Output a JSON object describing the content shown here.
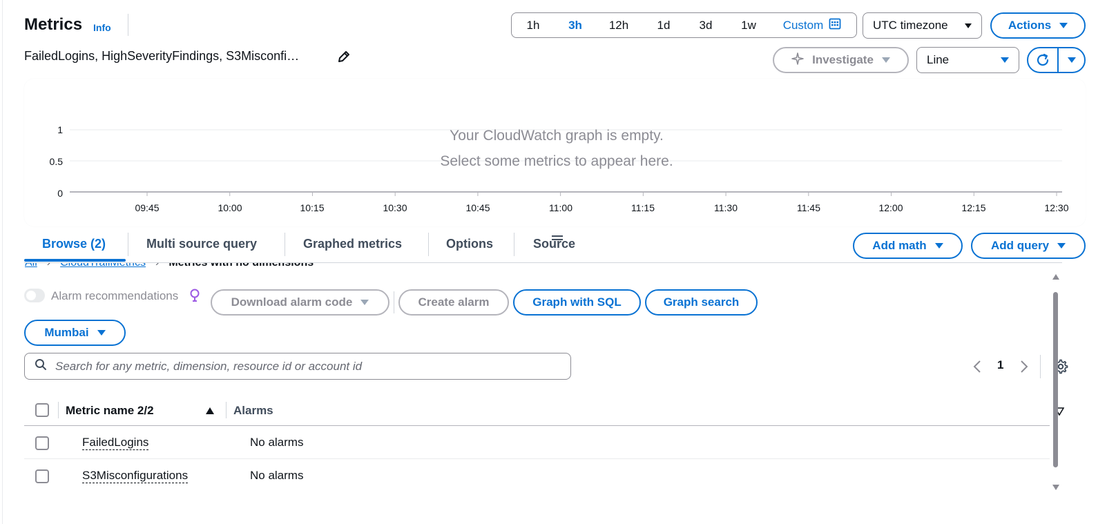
{
  "header": {
    "title": "Metrics",
    "info_link": "Info",
    "subtitle": "FailedLogins, HighSeverityFindings, S3Misconfi…"
  },
  "time_range": {
    "options": [
      "1h",
      "3h",
      "12h",
      "1d",
      "3d",
      "1w"
    ],
    "selected": "3h",
    "custom_label": "Custom"
  },
  "timezone": {
    "selected": "UTC timezone"
  },
  "actions_label": "Actions",
  "investigate_label": "Investigate",
  "chart_type": {
    "selected": "Line"
  },
  "chart": {
    "empty_title": "Your CloudWatch graph is empty.",
    "empty_subtitle": "Select some metrics to appear here.",
    "y_ticks": [
      "1",
      "0.5",
      "0"
    ],
    "x_ticks": [
      "09:45",
      "10:00",
      "10:15",
      "10:30",
      "10:45",
      "11:00",
      "11:15",
      "11:30",
      "11:45",
      "12:00",
      "12:15",
      "12:30"
    ]
  },
  "tabs": [
    {
      "label": "Browse (2)",
      "active": true
    },
    {
      "label": "Multi source query",
      "active": false
    },
    {
      "label": "Graphed metrics",
      "active": false
    },
    {
      "label": "Options",
      "active": false
    },
    {
      "label": "Source",
      "active": false
    }
  ],
  "tab_actions": {
    "add_math": "Add math",
    "add_query": "Add query"
  },
  "breadcrumb": [
    "All",
    "CloudTrailMetrics",
    "Metrics with no dimensions"
  ],
  "toolbar": {
    "alarm_recommendations": "Alarm recommendations",
    "download_alarm_code": "Download alarm code",
    "create_alarm": "Create alarm",
    "graph_with_sql": "Graph with SQL",
    "graph_search": "Graph search"
  },
  "region": {
    "selected": "Mumbai"
  },
  "search": {
    "placeholder": "Search for any metric, dimension, resource id or account id"
  },
  "pagination": {
    "current_page": "1"
  },
  "table": {
    "columns": [
      "Metric name 2/2",
      "Alarms"
    ],
    "rows": [
      {
        "metric": "FailedLogins",
        "alarms": "No alarms"
      },
      {
        "metric": "S3Misconfigurations",
        "alarms": "No alarms"
      }
    ]
  },
  "colors": {
    "accent": "#0972d3",
    "text": "#0f141a",
    "muted": "#8c8c94",
    "border": "#8c8c94"
  }
}
